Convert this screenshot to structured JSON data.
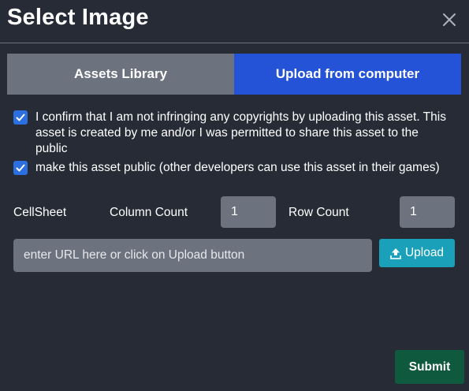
{
  "dialog": {
    "title": "Select Image",
    "close_icon": "close-icon"
  },
  "tabs": [
    {
      "label": "Assets Library",
      "active": false
    },
    {
      "label": "Upload from computer",
      "active": true
    }
  ],
  "checkboxes": [
    {
      "checked": true,
      "label": "I confirm that I am not infringing any copyrights by uploading this asset. This asset is created by me and/or I was permitted to share this asset to the public"
    },
    {
      "checked": true,
      "label": "make this asset public (other developers can use this asset in their games)"
    }
  ],
  "cellsheet": {
    "label": "CellSheet",
    "column_count_label": "Column Count",
    "column_count_value": "1",
    "row_count_label": "Row Count",
    "row_count_value": "1"
  },
  "url": {
    "placeholder": "enter URL here or click on Upload button",
    "value": ""
  },
  "upload_button": {
    "label": "Upload",
    "icon": "upload-icon"
  },
  "submit_button": {
    "label": "Submit"
  },
  "colors": {
    "background": "#262b36",
    "tab_inactive": "#6c737f",
    "tab_active": "#2453d8",
    "checkbox": "#2c6fe0",
    "upload_button": "#1aa0b8",
    "submit_button": "#0f5a3e"
  }
}
